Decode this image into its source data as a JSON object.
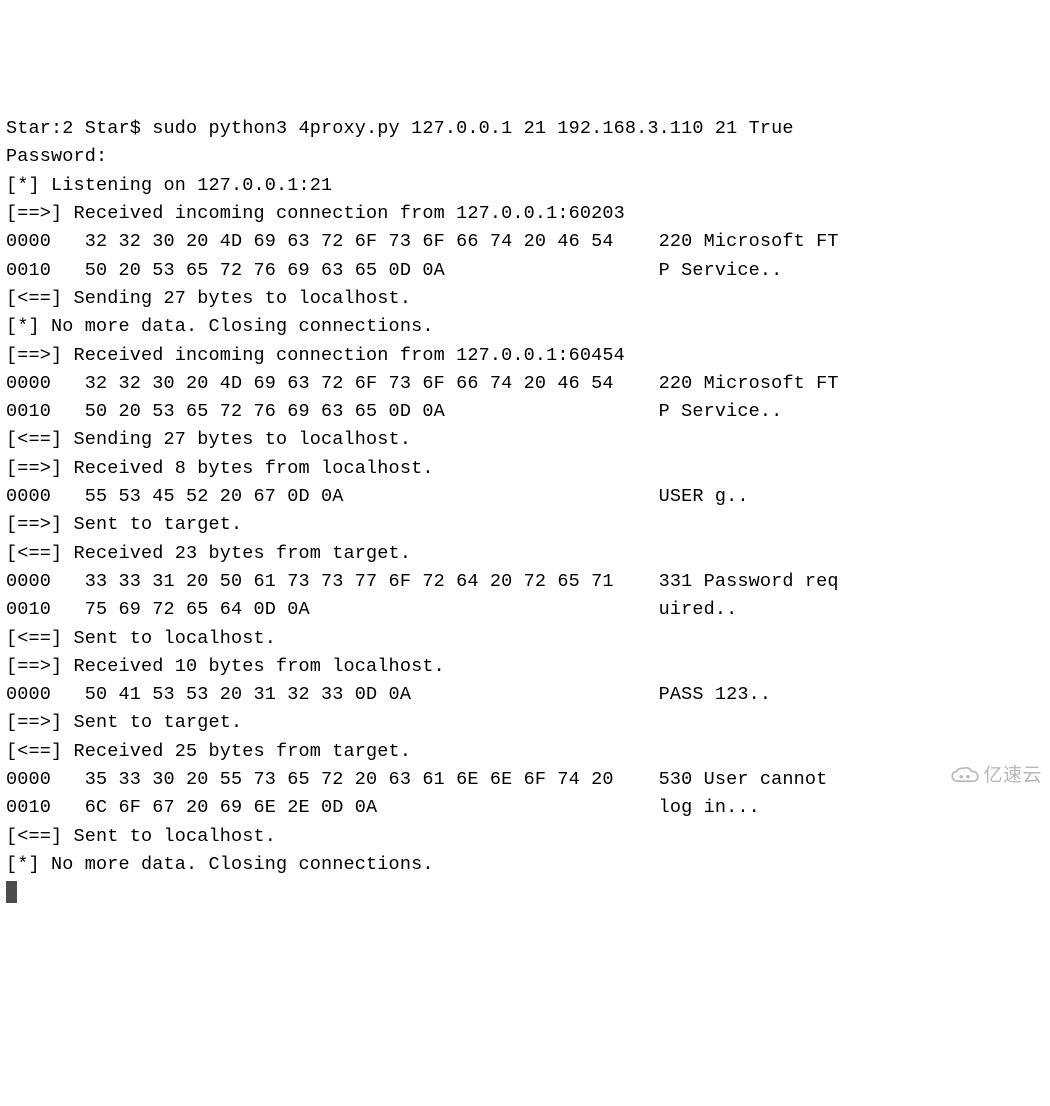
{
  "terminal": {
    "lines": [
      "Star:2 Star$ sudo python3 4proxy.py 127.0.0.1 21 192.168.3.110 21 True",
      "Password:",
      "[*] Listening on 127.0.0.1:21",
      "[==>] Received incoming connection from 127.0.0.1:60203",
      "0000   32 32 30 20 4D 69 63 72 6F 73 6F 66 74 20 46 54    220 Microsoft FT",
      "0010   50 20 53 65 72 76 69 63 65 0D 0A                   P Service..",
      "[<==] Sending 27 bytes to localhost.",
      "[*] No more data. Closing connections.",
      "[==>] Received incoming connection from 127.0.0.1:60454",
      "0000   32 32 30 20 4D 69 63 72 6F 73 6F 66 74 20 46 54    220 Microsoft FT",
      "0010   50 20 53 65 72 76 69 63 65 0D 0A                   P Service..",
      "[<==] Sending 27 bytes to localhost.",
      "[==>] Received 8 bytes from localhost.",
      "0000   55 53 45 52 20 67 0D 0A                            USER g..",
      "[==>] Sent to target.",
      "[<==] Received 23 bytes from target.",
      "0000   33 33 31 20 50 61 73 73 77 6F 72 64 20 72 65 71    331 Password req",
      "0010   75 69 72 65 64 0D 0A                               uired..",
      "[<==] Sent to localhost.",
      "[==>] Received 10 bytes from localhost.",
      "0000   50 41 53 53 20 31 32 33 0D 0A                      PASS 123..",
      "[==>] Sent to target.",
      "[<==] Received 25 bytes from target.",
      "0000   35 33 30 20 55 73 65 72 20 63 61 6E 6E 6F 74 20    530 User cannot",
      "0010   6C 6F 67 20 69 6E 2E 0D 0A                         log in...",
      "[<==] Sent to localhost.",
      "[*] No more data. Closing connections."
    ]
  },
  "watermark": {
    "text": "亿速云"
  }
}
